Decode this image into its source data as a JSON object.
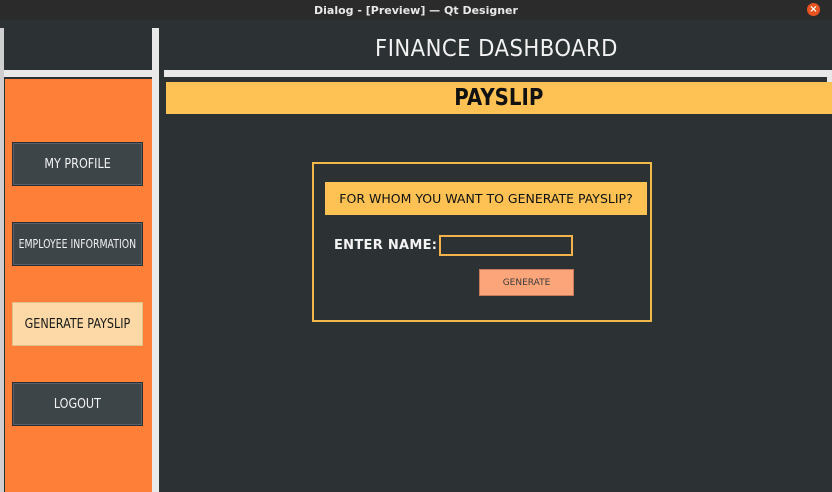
{
  "window": {
    "title": "Dialog - [Preview] — Qt Designer",
    "close_glyph": "×"
  },
  "header": {
    "title": "FINANCE DASHBOARD"
  },
  "sidebar": {
    "items": [
      {
        "label": "MY PROFILE",
        "active": false
      },
      {
        "label": "EMPLOYEE INFORMATION",
        "active": false
      },
      {
        "label": "GENERATE PAYSLIP",
        "active": true
      },
      {
        "label": "LOGOUT",
        "active": false
      }
    ]
  },
  "page": {
    "banner": "PAYSLIP",
    "question": "FOR WHOM YOU WANT TO GENERATE PAYSLIP?",
    "name_label": "ENTER NAME:",
    "name_value": "",
    "generate_label": "GENERATE"
  },
  "colors": {
    "background": "#2c3134",
    "sidebar": "#fe7f37",
    "banner": "#fec254",
    "active_button": "#fcd9a6",
    "button": "#3d4549",
    "generate_button": "#fda57a"
  },
  "icons": {
    "close": "close-icon"
  }
}
